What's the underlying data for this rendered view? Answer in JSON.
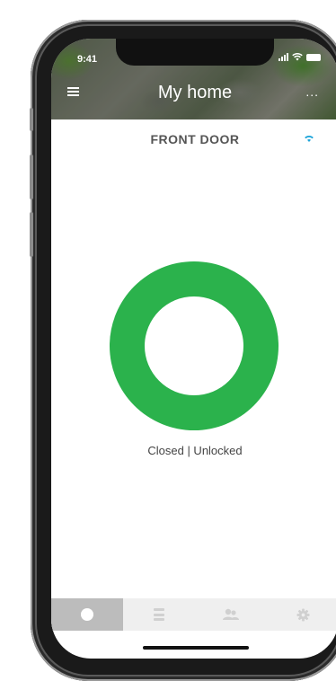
{
  "status_bar": {
    "time": "9:41"
  },
  "header": {
    "title": "My home",
    "more_glyph": "..."
  },
  "door": {
    "name": "FRONT DOOR",
    "connection_icon": "wifi-icon"
  },
  "lock_state": {
    "text": "Closed | Unlocked",
    "ring_color": "#2bb24c"
  },
  "colors": {
    "accent_wifi": "#1aa3d9",
    "tab_active_bg": "#bcbcbc",
    "tab_icon": "#d0d0d0"
  },
  "tabs": [
    {
      "name": "status",
      "icon": "circle-dot-icon",
      "active": true
    },
    {
      "name": "log",
      "icon": "list-icon",
      "active": false
    },
    {
      "name": "users",
      "icon": "users-icon",
      "active": false
    },
    {
      "name": "settings",
      "icon": "gear-icon",
      "active": false
    }
  ]
}
